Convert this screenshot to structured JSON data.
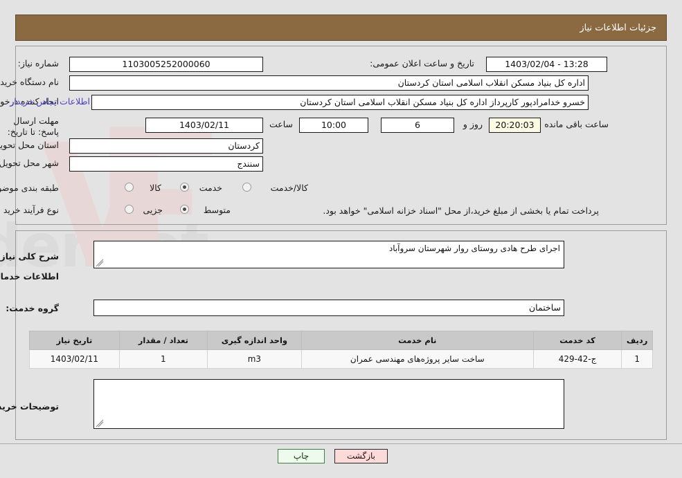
{
  "header": {
    "title": "جزئیات اطلاعات نیاز",
    "bar_color": "#8b6a42"
  },
  "summary": {
    "need_number_label": "شماره نیاز:",
    "need_number_value": "1103005252000060",
    "public_announce_label": "تاریخ و ساعت اعلان عمومی:",
    "public_announce_value": "13:28 - 1403/02/04",
    "buyer_org_label": "نام دستگاه خریدار:",
    "buyer_org_value": "اداره کل بنیاد مسکن انقلاب اسلامی استان کردستان",
    "requester_label": "ایجاد کننده درخواست:",
    "requester_value": "خسرو خدامرادپور کارپرداز اداره کل بنیاد مسکن انقلاب اسلامی استان کردستان",
    "buyer_contact_link": "اطلاعات تماس خریدار",
    "deadline_label": "مهلت ارسال پاسخ: تا تاریخ:",
    "deadline_date": "1403/02/11",
    "hour_label": "ساعت",
    "deadline_time": "10:00",
    "remaining_days": "6",
    "days_and_label": "روز و",
    "remaining_time": "20:20:03",
    "remaining_suffix": "ساعت باقی مانده",
    "province_label": "استان محل تحویل:",
    "province_value": "کردستان",
    "city_label": "شهر محل تحویل:",
    "city_value": "سنندج",
    "classification_label": "طبقه بندی موضوعی:",
    "classification_options": [
      {
        "label": "کالا",
        "selected": false
      },
      {
        "label": "خدمت",
        "selected": true
      },
      {
        "label": "کالا/خدمت",
        "selected": false
      }
    ],
    "process_type_label": "نوع فرآیند خرید :",
    "process_type_options": [
      {
        "label": "جزیی",
        "selected": false
      },
      {
        "label": "متوسط",
        "selected": true
      }
    ],
    "treasury_note": "پرداخت تمام یا بخشی از مبلغ خرید،از محل \"اسناد خزانه اسلامی\" خواهد بود.",
    "link_color": "#4a3fc8"
  },
  "details": {
    "general_desc_label": "شرح کلی نیاز:",
    "general_desc_value": "اجرای طرح هادی روستای روار شهرستان سروآباد",
    "services_section_title": "اطلاعات خدمات مورد نیاز",
    "service_group_label": "گروه خدمت:",
    "service_group_value": "ساختمان",
    "buyer_notes_label": "توضیحات خریدار;",
    "buyer_notes_value": ""
  },
  "table": {
    "headers": [
      "ردیف",
      "کد خدمت",
      "نام خدمت",
      "واحد اندازه گیری",
      "تعداد / مقدار",
      "تاریخ نیاز"
    ],
    "rows": [
      {
        "row_no": "1",
        "service_code": "ج-42-429",
        "service_name": "ساخت سایر پروژه‌های مهندسی عمران",
        "unit": "m3",
        "quantity": "1",
        "need_date": "1403/02/11"
      }
    ]
  },
  "footer": {
    "print_label": "چاپ",
    "back_label": "بازگشت",
    "print_color": "#eefaee",
    "back_color": "#fbdada"
  },
  "watermark": {
    "text": "AriaTender.net"
  }
}
